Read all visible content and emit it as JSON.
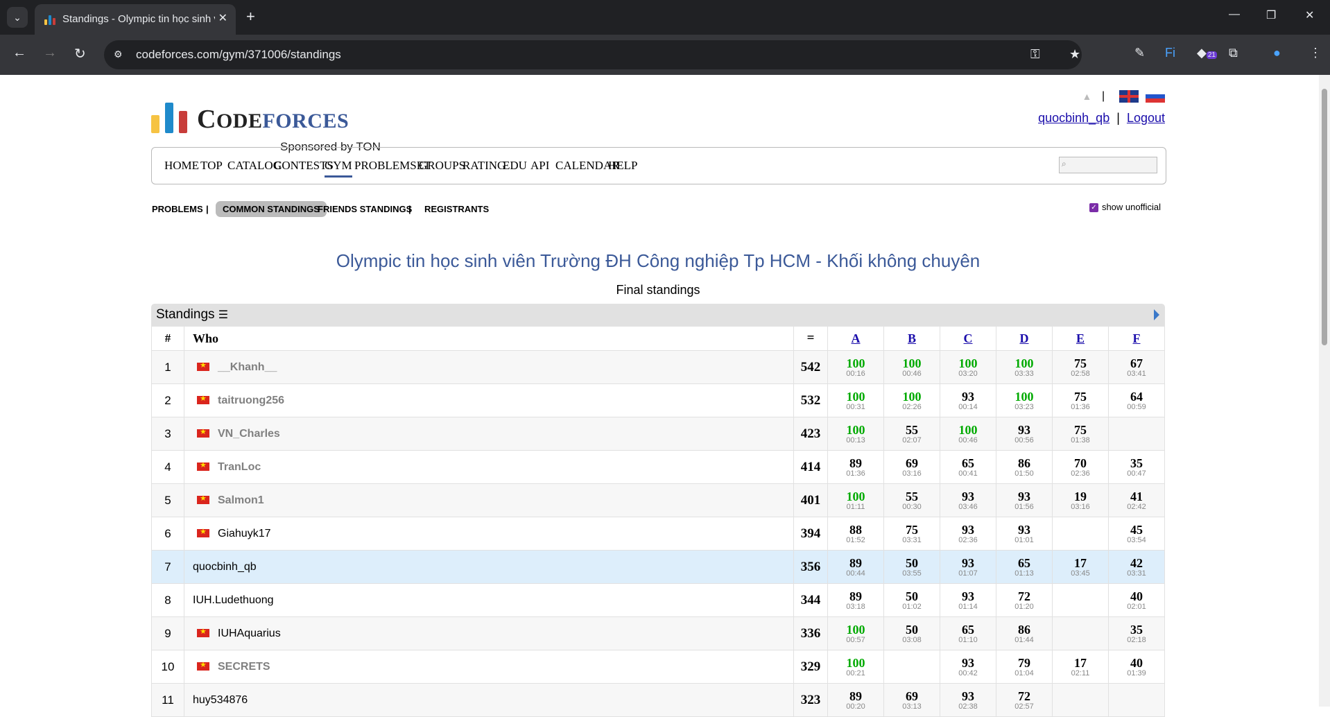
{
  "browser": {
    "tab_title": "Standings - Olympic tin học sinh viên",
    "url": "codeforces.com/gym/371006/standings",
    "ext_badge": "21"
  },
  "header": {
    "logo_text_1": "C",
    "logo_text_2": "ODE",
    "logo_text_3": "FORCES",
    "sponsor": "Sponsored by TON",
    "username": "quocbinh_qb",
    "logout": "Logout",
    "separator": "|"
  },
  "menu": [
    "HOME",
    "TOP",
    "CATALOG",
    "CONTESTS",
    "GYM",
    "PROBLEMSET",
    "GROUPS",
    "RATING",
    "EDU",
    "API",
    "CALENDAR",
    "HELP"
  ],
  "submenu": {
    "problems": "PROBLEMS",
    "common": "COMMON STANDINGS",
    "friends": "FRIENDS STANDINGS",
    "registrants": "REGISTRANTS",
    "sep": "|",
    "show_unofficial": "show unofficial"
  },
  "contest": {
    "title": "Olympic tin học sinh viên Trường ĐH Công nghiệp Tp HCM - Khối không chuyên",
    "subtitle": "Final standings"
  },
  "standings": {
    "label": "Standings",
    "head_rank": "#",
    "head_who": "Who",
    "head_pen": "=",
    "problems": [
      "A",
      "B",
      "C",
      "D",
      "E",
      "F"
    ],
    "rows": [
      {
        "rank": "1",
        "who": "__Khanh__",
        "flag": true,
        "gray": true,
        "total": "542",
        "cells": [
          [
            "100",
            "00:16"
          ],
          [
            "100",
            "00:46"
          ],
          [
            "100",
            "03:20"
          ],
          [
            "100",
            "03:33"
          ],
          [
            "75",
            "02:58"
          ],
          [
            "67",
            "03:41"
          ]
        ]
      },
      {
        "rank": "2",
        "who": "taitruong256",
        "flag": true,
        "gray": true,
        "total": "532",
        "cells": [
          [
            "100",
            "00:31"
          ],
          [
            "100",
            "02:26"
          ],
          [
            "93",
            "00:14"
          ],
          [
            "100",
            "03:23"
          ],
          [
            "75",
            "01:36"
          ],
          [
            "64",
            "00:59"
          ]
        ]
      },
      {
        "rank": "3",
        "who": "VN_Charles",
        "flag": true,
        "gray": true,
        "total": "423",
        "cells": [
          [
            "100",
            "00:13"
          ],
          [
            "55",
            "02:07"
          ],
          [
            "100",
            "00:46"
          ],
          [
            "93",
            "00:56"
          ],
          [
            "75",
            "01:38"
          ],
          [
            "",
            ""
          ]
        ]
      },
      {
        "rank": "4",
        "who": "TranLoc",
        "flag": true,
        "gray": true,
        "total": "414",
        "cells": [
          [
            "89",
            "01:36"
          ],
          [
            "69",
            "03:16"
          ],
          [
            "65",
            "00:41"
          ],
          [
            "86",
            "01:50"
          ],
          [
            "70",
            "02:36"
          ],
          [
            "35",
            "00:47"
          ]
        ]
      },
      {
        "rank": "5",
        "who": "Salmon1",
        "flag": true,
        "gray": true,
        "total": "401",
        "cells": [
          [
            "100",
            "01:11"
          ],
          [
            "55",
            "00:30"
          ],
          [
            "93",
            "03:46"
          ],
          [
            "93",
            "01:56"
          ],
          [
            "19",
            "03:16"
          ],
          [
            "41",
            "02:42"
          ]
        ]
      },
      {
        "rank": "6",
        "who": "Giahuyk17",
        "flag": true,
        "gray": false,
        "total": "394",
        "cells": [
          [
            "88",
            "01:52"
          ],
          [
            "75",
            "03:31"
          ],
          [
            "93",
            "02:36"
          ],
          [
            "93",
            "01:01"
          ],
          [
            "",
            ""
          ],
          [
            "45",
            "03:54"
          ]
        ]
      },
      {
        "rank": "7",
        "who": "quocbinh_qb",
        "flag": false,
        "gray": false,
        "me": true,
        "total": "356",
        "cells": [
          [
            "89",
            "00:44"
          ],
          [
            "50",
            "03:55"
          ],
          [
            "93",
            "01:07"
          ],
          [
            "65",
            "01:13"
          ],
          [
            "17",
            "03:45"
          ],
          [
            "42",
            "03:31"
          ]
        ]
      },
      {
        "rank": "8",
        "who": "IUH.Ludethuong",
        "flag": false,
        "gray": false,
        "total": "344",
        "cells": [
          [
            "89",
            "03:18"
          ],
          [
            "50",
            "01:02"
          ],
          [
            "93",
            "01:14"
          ],
          [
            "72",
            "01:20"
          ],
          [
            "",
            ""
          ],
          [
            "40",
            "02:01"
          ]
        ]
      },
      {
        "rank": "9",
        "who": "IUHAquarius",
        "flag": true,
        "gray": false,
        "total": "336",
        "cells": [
          [
            "100",
            "00:57"
          ],
          [
            "50",
            "03:08"
          ],
          [
            "65",
            "01:10"
          ],
          [
            "86",
            "01:44"
          ],
          [
            "",
            ""
          ],
          [
            "35",
            "02:18"
          ]
        ]
      },
      {
        "rank": "10",
        "who": "SECRETS",
        "flag": true,
        "gray": true,
        "total": "329",
        "cells": [
          [
            "100",
            "00:21"
          ],
          [
            "",
            ""
          ],
          [
            "93",
            "00:42"
          ],
          [
            "79",
            "01:04"
          ],
          [
            "17",
            "02:11"
          ],
          [
            "40",
            "01:39"
          ]
        ]
      },
      {
        "rank": "11",
        "who": "huy534876",
        "flag": false,
        "gray": false,
        "total": "323",
        "cells": [
          [
            "89",
            "00:20"
          ],
          [
            "69",
            "03:13"
          ],
          [
            "93",
            "02:38"
          ],
          [
            "72",
            "02:57"
          ],
          [
            "",
            ""
          ],
          [
            "",
            ""
          ]
        ]
      }
    ]
  }
}
